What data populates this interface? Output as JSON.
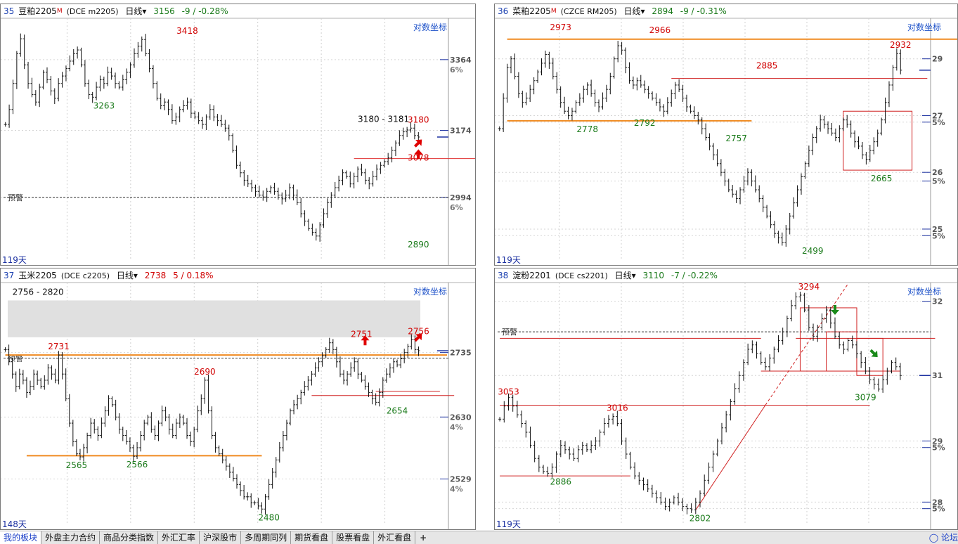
{
  "panels": [
    {
      "id": "p35",
      "num": "35",
      "name": "豆粕2205",
      "mark": "M",
      "code": "(DCE m2205)",
      "period": "日线",
      "price": "3156",
      "change": "-9 / -0.28%",
      "change_dir": "down",
      "log_label": "对数坐标",
      "days": "119天",
      "alert": "预警",
      "yrange": [
        2850,
        3460
      ],
      "axis": [
        {
          "v": 3364,
          "pct": "6%"
        },
        {
          "v": 3174,
          "pct": ""
        },
        {
          "v": 2994,
          "pct": "6%"
        }
      ],
      "labels": [
        {
          "t": "3418",
          "c": "red",
          "v": 3418,
          "i": 48
        },
        {
          "t": "3263",
          "c": "green",
          "v": 3263,
          "i": 26
        },
        {
          "t": "3180 - 3181",
          "c": "black",
          "v": 3181,
          "i": 93
        },
        {
          "t": "3078",
          "c": "red",
          "v": 3078,
          "i": 109
        },
        {
          "t": "3180",
          "c": "red",
          "v": 3180,
          "i": 164
        },
        {
          "t": "2890",
          "c": "green",
          "v": 2890,
          "i": 122
        }
      ],
      "hlines": [
        {
          "v": 3098,
          "c": "#e03030",
          "from": 92,
          "to": 160
        }
      ],
      "boxes": [
        {
          "from": 130,
          "to": 157,
          "hi": 3098,
          "lo": 2998
        },
        {
          "from": 143,
          "to": 157,
          "hi": 3098,
          "lo": 2998
        }
      ],
      "alert_v": 2994,
      "series": [
        3190,
        3230,
        3300,
        3380,
        3420,
        3350,
        3300,
        3270,
        3250,
        3290,
        3330,
        3310,
        3280,
        3260,
        3300,
        3320,
        3340,
        3360,
        3380,
        3390,
        3350,
        3300,
        3270,
        3263,
        3290,
        3310,
        3300,
        3330,
        3320,
        3300,
        3290,
        3310,
        3330,
        3350,
        3380,
        3400,
        3418,
        3380,
        3340,
        3300,
        3260,
        3240,
        3250,
        3230,
        3200,
        3210,
        3230,
        3240,
        3250,
        3220,
        3210,
        3200,
        3190,
        3210,
        3230,
        3210,
        3200,
        3190,
        3180,
        3160,
        3120,
        3080,
        3060,
        3040,
        3030,
        3020,
        3010,
        3000,
        2995,
        3010,
        3020,
        3010,
        3000,
        2990,
        3000,
        3020,
        3000,
        2980,
        2950,
        2930,
        2910,
        2900,
        2890,
        2920,
        2950,
        2980,
        3000,
        3020,
        3040,
        3060,
        3050,
        3030,
        3050,
        3070,
        3060,
        3040,
        3030,
        3050,
        3070,
        3080,
        3090,
        3100,
        3120,
        3140,
        3160,
        3170,
        3175,
        3180,
        3160,
        3156
      ]
    },
    {
      "id": "p36",
      "num": "36",
      "name": "菜粕2205",
      "mark": "M",
      "code": "(CZCE RM205)",
      "period": "日线",
      "price": "2894",
      "change": "-9 / -0.31%",
      "change_dir": "down",
      "log_label": "对数坐标",
      "days": "119天",
      "alert": "",
      "yrange": [
        2480,
        3000
      ],
      "axis": [
        {
          "v": 2920,
          "pct": "29"
        },
        {
          "v": 2790,
          "pct": "27"
        },
        {
          "v": 2775,
          "pct": "5%"
        },
        {
          "v": 2660,
          "pct": "26"
        },
        {
          "v": 2640,
          "pct": "5%"
        },
        {
          "v": 2530,
          "pct": "25"
        },
        {
          "v": 2515,
          "pct": "5%"
        }
      ],
      "labels": [
        {
          "t": "2973",
          "c": "red",
          "v": 2973,
          "i": 16
        },
        {
          "t": "2966",
          "c": "red",
          "v": 2966,
          "i": 42
        },
        {
          "t": "2885",
          "c": "red",
          "v": 2885,
          "i": 70
        },
        {
          "t": "2778",
          "c": "green",
          "v": 2778,
          "i": 23
        },
        {
          "t": "2792",
          "c": "green",
          "v": 2792,
          "i": 38
        },
        {
          "t": "2757",
          "c": "green",
          "v": 2757,
          "i": 62
        },
        {
          "t": "2665",
          "c": "green",
          "v": 2665,
          "i": 100
        },
        {
          "t": "2499",
          "c": "green",
          "v": 2499,
          "i": 82
        },
        {
          "t": "2932",
          "c": "red",
          "v": 2932,
          "i": 112
        }
      ],
      "hlines": [
        {
          "v": 2965,
          "c": "#f08a20",
          "from": 2,
          "to": 125,
          "w": 2
        },
        {
          "v": 2875,
          "c": "#d02020",
          "from": 45,
          "to": 112
        },
        {
          "v": 2778,
          "c": "#f08a20",
          "from": 2,
          "to": 66,
          "w": 2
        }
      ],
      "boxes": [
        {
          "from": 90,
          "to": 108,
          "hi": 2800,
          "lo": 2665
        }
      ],
      "series": [
        2760,
        2830,
        2900,
        2920,
        2880,
        2840,
        2820,
        2830,
        2850,
        2870,
        2890,
        2910,
        2930,
        2910,
        2880,
        2850,
        2820,
        2800,
        2790,
        2800,
        2820,
        2830,
        2850,
        2860,
        2840,
        2820,
        2810,
        2830,
        2850,
        2880,
        2920,
        2950,
        2940,
        2900,
        2870,
        2860,
        2870,
        2860,
        2850,
        2840,
        2830,
        2820,
        2810,
        2800,
        2820,
        2840,
        2860,
        2850,
        2830,
        2810,
        2800,
        2790,
        2780,
        2760,
        2740,
        2720,
        2700,
        2680,
        2660,
        2640,
        2620,
        2610,
        2600,
        2620,
        2640,
        2660,
        2640,
        2620,
        2600,
        2580,
        2560,
        2540,
        2520,
        2510,
        2499,
        2530,
        2560,
        2590,
        2620,
        2650,
        2680,
        2710,
        2740,
        2760,
        2780,
        2770,
        2760,
        2750,
        2740,
        2760,
        2780,
        2770,
        2750,
        2730,
        2720,
        2700,
        2690,
        2710,
        2730,
        2750,
        2780,
        2820,
        2860,
        2900,
        2932,
        2894
      ]
    },
    {
      "id": "p37",
      "num": "37",
      "name": "玉米2205",
      "mark": "",
      "code": "(DCE c2205)",
      "period": "日线",
      "price": "2738",
      "change": "5 / 0.18%",
      "change_dir": "up",
      "log_label": "对数坐标",
      "days": "148天",
      "alert": "预警",
      "yrange": [
        2470,
        2840
      ],
      "axis": [
        {
          "v": 2735,
          "pct": ""
        },
        {
          "v": 2630,
          "pct": "4%"
        },
        {
          "v": 2529,
          "pct": "4%"
        }
      ],
      "labels": [
        {
          "t": "2756 - 2820",
          "c": "black",
          "v": 2820,
          "i": 2
        },
        {
          "t": "2731",
          "c": "red",
          "v": 2731,
          "i": 15
        },
        {
          "t": "2690",
          "c": "red",
          "v": 2690,
          "i": 56
        },
        {
          "t": "2565",
          "c": "green",
          "v": 2565,
          "i": 20
        },
        {
          "t": "2566",
          "c": "green",
          "v": 2566,
          "i": 37
        },
        {
          "t": "2480",
          "c": "green",
          "v": 2480,
          "i": 74
        },
        {
          "t": "2751",
          "c": "red",
          "v": 2751,
          "i": 100
        },
        {
          "t": "2654",
          "c": "green",
          "v": 2654,
          "i": 110
        },
        {
          "t": "2756",
          "c": "red",
          "v": 2756,
          "i": 124
        }
      ],
      "zone": {
        "hi": 2820,
        "lo": 2760
      },
      "hlines": [
        {
          "v": 2731,
          "c": "#f08a20",
          "from": 0,
          "to": 124,
          "w": 2
        },
        {
          "v": 2567,
          "c": "#f08a20",
          "from": 6,
          "to": 72,
          "w": 2
        },
        {
          "v": 2665,
          "c": "#d02020",
          "from": 86,
          "to": 126
        },
        {
          "v": 2672,
          "c": "#d02020",
          "from": 104,
          "to": 122
        }
      ],
      "alert_v": 2726,
      "series": [
        2740,
        2720,
        2700,
        2680,
        2700,
        2690,
        2670,
        2680,
        2700,
        2690,
        2680,
        2690,
        2710,
        2700,
        2690,
        2731,
        2700,
        2660,
        2620,
        2590,
        2570,
        2565,
        2580,
        2600,
        2620,
        2610,
        2600,
        2620,
        2640,
        2660,
        2650,
        2630,
        2610,
        2600,
        2590,
        2580,
        2566,
        2580,
        2600,
        2620,
        2630,
        2610,
        2600,
        2620,
        2640,
        2630,
        2610,
        2600,
        2620,
        2630,
        2620,
        2600,
        2590,
        2610,
        2640,
        2660,
        2690,
        2640,
        2600,
        2580,
        2570,
        2560,
        2550,
        2540,
        2530,
        2520,
        2510,
        2500,
        2500,
        2490,
        2490,
        2485,
        2480,
        2500,
        2520,
        2540,
        2560,
        2580,
        2600,
        2620,
        2640,
        2650,
        2660,
        2670,
        2680,
        2690,
        2700,
        2710,
        2720,
        2730,
        2740,
        2751,
        2740,
        2720,
        2700,
        2690,
        2700,
        2710,
        2720,
        2700,
        2690,
        2680,
        2670,
        2660,
        2654,
        2670,
        2690,
        2700,
        2710,
        2720,
        2715,
        2725,
        2735,
        2745,
        2756,
        2740,
        2738
      ]
    },
    {
      "id": "p38",
      "num": "38",
      "name": "淀粉2201",
      "mark": "",
      "code": "(DCE cs2201)",
      "period": "日线",
      "price": "3110",
      "change": "-7 / -0.22%",
      "change_dir": "down",
      "log_label": "对数坐标",
      "days": "119天",
      "alert": "预警",
      "yrange": [
        2790,
        3310
      ],
      "axis": [
        {
          "v": 3280,
          "pct": "32"
        },
        {
          "v": 3110,
          "pct": "31"
        },
        {
          "v": 2960,
          "pct": "29"
        },
        {
          "v": 2945,
          "pct": "5%"
        },
        {
          "v": 2820,
          "pct": "28"
        },
        {
          "v": 2805,
          "pct": "5%"
        }
      ],
      "labels": [
        {
          "t": "3294",
          "c": "red",
          "v": 3294,
          "i": 71
        },
        {
          "t": "3053",
          "c": "red",
          "v": 3053,
          "i": 2
        },
        {
          "t": "3016",
          "c": "red",
          "v": 3016,
          "i": 27
        },
        {
          "t": "2886",
          "c": "green",
          "v": 2886,
          "i": 14
        },
        {
          "t": "2802",
          "c": "green",
          "v": 2802,
          "i": 46
        },
        {
          "t": "3079",
          "c": "green",
          "v": 3079,
          "i": 84
        }
      ],
      "hlines": [
        {
          "v": 3195,
          "c": "#d02020",
          "from": 0,
          "to": 60
        },
        {
          "v": 3195,
          "c": "#d02020",
          "from": 68,
          "to": 100
        },
        {
          "v": 3042,
          "c": "#d02020",
          "from": 0,
          "to": 85
        },
        {
          "v": 2880,
          "c": "#d02020",
          "from": 0,
          "to": 30
        },
        {
          "v": 3120,
          "c": "#d02020",
          "from": 60,
          "to": 92
        }
      ],
      "boxes": [
        {
          "from": 69,
          "to": 82,
          "hi": 3265,
          "lo": 3120
        },
        {
          "from": 75,
          "to": 82,
          "hi": 3210,
          "lo": 3120
        },
        {
          "from": 82,
          "to": 88,
          "hi": 3195,
          "lo": 3110
        }
      ],
      "alert_v": 3210,
      "series": [
        3010,
        3040,
        3060,
        3040,
        3020,
        3000,
        2980,
        2950,
        2920,
        2900,
        2890,
        2886,
        2900,
        2930,
        2950,
        2940,
        2930,
        2920,
        2940,
        2950,
        2940,
        2950,
        2960,
        2980,
        3000,
        3010,
        3016,
        3000,
        2960,
        2930,
        2900,
        2880,
        2870,
        2860,
        2850,
        2840,
        2830,
        2820,
        2810,
        2820,
        2830,
        2820,
        2810,
        2805,
        2802,
        2820,
        2840,
        2870,
        2900,
        2930,
        2960,
        2990,
        3020,
        3050,
        3080,
        3110,
        3140,
        3170,
        3180,
        3160,
        3140,
        3130,
        3150,
        3170,
        3190,
        3210,
        3240,
        3270,
        3290,
        3294,
        3260,
        3220,
        3200,
        3220,
        3240,
        3260,
        3230,
        3200,
        3180,
        3170,
        3190,
        3180,
        3160,
        3140,
        3120,
        3100,
        3090,
        3079,
        3100,
        3120,
        3140,
        3130,
        3110
      ]
    }
  ],
  "arrows": [
    {
      "panel": "p35",
      "dir": "up",
      "i": 131,
      "v": 3110,
      "color": "#e00000"
    },
    {
      "panel": "p35",
      "dir": "upright",
      "i": 156,
      "v": 3140,
      "color": "#e00000"
    },
    {
      "panel": "p37",
      "dir": "up",
      "i": 101,
      "v": 2755,
      "color": "#e00000"
    },
    {
      "panel": "p37",
      "dir": "upright",
      "i": 119,
      "v": 2760,
      "color": "#e00000"
    },
    {
      "panel": "p38",
      "dir": "down",
      "i": 77,
      "v": 3260,
      "color": "#1a8a1a"
    },
    {
      "panel": "p38",
      "dir": "downright",
      "i": 86,
      "v": 3160,
      "color": "#1a8a1a"
    }
  ],
  "statusbar": {
    "tabs": [
      "我的板块",
      "外盘主力合约",
      "商品分类指数",
      "外汇汇率",
      "沪深股市",
      "多周期同列",
      "期货看盘",
      "股票看盘",
      "外汇看盘"
    ],
    "plus": "+",
    "right_label": "论坛"
  },
  "colors": {
    "up": "#d00000",
    "down": "#1a7a1a",
    "bar": "#111111",
    "grid": "#c8c8c8",
    "orange": "#f08a20",
    "red_line": "#d02020"
  }
}
